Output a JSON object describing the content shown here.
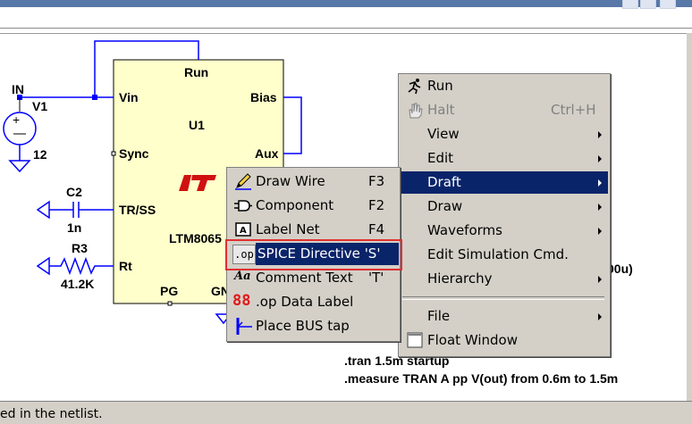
{
  "status_text": "ed in the netlist.",
  "schematic": {
    "labels": {
      "in": "IN",
      "v1": "V1",
      "v1_val": "12",
      "c2": "C2",
      "c2_val": "1n",
      "r3": "R3",
      "r3_val": "41.2K",
      "run": "Run",
      "vin": "Vin",
      "bias": "Bias",
      "u1": "U1",
      "sync": "Sync",
      "aux": "Aux",
      "trss": "TR/SS",
      "part": "LTM8065",
      "rt": "Rt",
      "pg": "PG",
      "gnd": "GN",
      "partial": "00u)",
      "tran": ".tran 1.5m startup",
      "measure": ".measure TRAN A pp V(out) from 0.6m to 1.5m"
    }
  },
  "main_menu": {
    "items": [
      {
        "label": "Run",
        "shortcut": "",
        "icon": "run-icon"
      },
      {
        "label": "Halt",
        "shortcut": "Ctrl+H",
        "icon": "hand-icon",
        "disabled": true
      },
      {
        "label": "View"
      },
      {
        "label": "Edit"
      },
      {
        "label": "Draft",
        "selected": true
      },
      {
        "label": "Draw"
      },
      {
        "label": "Waveforms"
      },
      {
        "label": "Edit Simulation Cmd."
      },
      {
        "label": "Hierarchy"
      },
      {
        "label": "File"
      },
      {
        "label": "Float Window"
      }
    ]
  },
  "draft_menu": {
    "items": [
      {
        "label": "Draw Wire",
        "shortcut": "F3",
        "icon": "pencil-icon"
      },
      {
        "label": "Component",
        "shortcut": "F2",
        "icon": "component-icon"
      },
      {
        "label": "Label Net",
        "shortcut": "F4",
        "icon": "label-icon"
      },
      {
        "label": "SPICE Directive",
        "shortcut": "'S'",
        "icon": ".op",
        "selected": true
      },
      {
        "label": "Comment Text",
        "shortcut": "'T'",
        "icon": "Aa"
      },
      {
        "label": ".op Data Label",
        "shortcut": "",
        "icon": "88"
      },
      {
        "label": "Place BUS tap",
        "shortcut": "",
        "icon": "bus-tap-icon"
      }
    ]
  }
}
